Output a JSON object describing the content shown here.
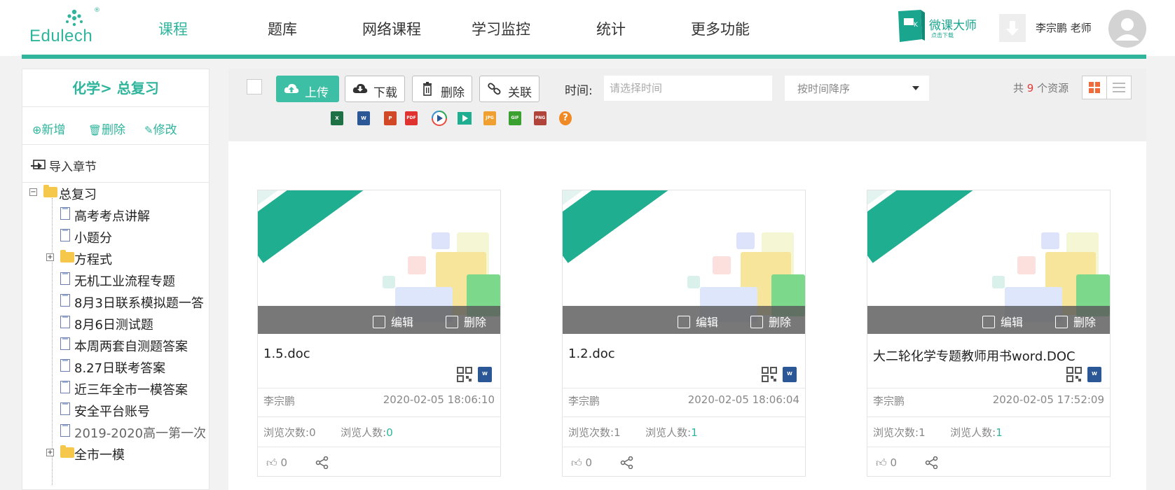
{
  "brand": {
    "logo_text": "Edulech",
    "logo_reg": "®"
  },
  "nav": [
    {
      "label": "课程",
      "active": true
    },
    {
      "label": "题库",
      "active": false
    },
    {
      "label": "网络课程",
      "active": false
    },
    {
      "label": "学习监控",
      "active": false
    },
    {
      "label": "统计",
      "active": false
    },
    {
      "label": "更多功能",
      "active": false
    }
  ],
  "weike": {
    "title": "微课大师",
    "subtitle": "点击下载"
  },
  "user": {
    "name": "李宗鹏 老师"
  },
  "sidebar": {
    "title": "化学> 总复习",
    "actions": {
      "add": "新增",
      "delete": "删除",
      "edit": "修改"
    },
    "import_label": "导入章节",
    "tree": [
      {
        "label": "总复习",
        "type": "folder",
        "expander": "minus"
      },
      {
        "label": "高考考点讲解",
        "type": "doc"
      },
      {
        "label": "小题分",
        "type": "doc"
      },
      {
        "label": "方程式",
        "type": "folder",
        "expander": "plus"
      },
      {
        "label": "无机工业流程专题",
        "type": "doc"
      },
      {
        "label": "8月3日联系模拟题一答",
        "type": "doc"
      },
      {
        "label": "8月6日测试题",
        "type": "doc"
      },
      {
        "label": "本周两套自测题答案",
        "type": "doc"
      },
      {
        "label": "8.27日联考答案",
        "type": "doc"
      },
      {
        "label": "近三年全市一模答案",
        "type": "doc"
      },
      {
        "label": "安全平台账号",
        "type": "doc"
      },
      {
        "label": "2019-2020高一第一次",
        "type": "doc"
      },
      {
        "label": "全市一模",
        "type": "folder",
        "expander": "plus"
      }
    ]
  },
  "toolbar": {
    "upload": "上传",
    "download": "下载",
    "delete": "删除",
    "link": "关联",
    "time_label": "时间:",
    "time_placeholder": "请选择时间",
    "sort_value": "按时间降序",
    "count_prefix": "共",
    "count_value": "9",
    "count_suffix": "个资源"
  },
  "file_filters": [
    {
      "name": "excel-filter-icon",
      "text": "X",
      "color": "#1e7145"
    },
    {
      "name": "word-filter-icon",
      "text": "W",
      "color": "#2b5797"
    },
    {
      "name": "ppt-filter-icon",
      "text": "P",
      "color": "#d24726"
    },
    {
      "name": "pdf-filter-icon",
      "text": "PDF",
      "color": "#e0322f"
    },
    {
      "name": "media-filter-icon",
      "text": "▶",
      "color": "#f39c12"
    },
    {
      "name": "video-filter-icon",
      "text": "▶",
      "color": "#1fae8f"
    },
    {
      "name": "jpg-filter-icon",
      "text": "JPG",
      "color": "#f0a030"
    },
    {
      "name": "gif-filter-icon",
      "text": "GIF",
      "color": "#3aa02f"
    },
    {
      "name": "png-filter-icon",
      "text": "PNG",
      "color": "#b0443a"
    },
    {
      "name": "other-filter-icon",
      "text": "?",
      "color": "#f08a24"
    }
  ],
  "cards": [
    {
      "ribbon": "Word",
      "edit": "编辑",
      "delete": "删除",
      "file_name": "1.5.doc",
      "author": "李宗鹏",
      "timestamp": "2020-02-05 18:06:10",
      "views_label": "浏览次数:",
      "views": "0",
      "viewers_label": "浏览人数:",
      "viewers": "0",
      "likes": "0"
    },
    {
      "ribbon": "Word",
      "edit": "编辑",
      "delete": "删除",
      "file_name": "1.2.doc",
      "author": "李宗鹏",
      "timestamp": "2020-02-05 18:06:04",
      "views_label": "浏览次数:",
      "views": "1",
      "viewers_label": "浏览人数:",
      "viewers": "1",
      "likes": "0"
    },
    {
      "ribbon": "Word",
      "edit": "编辑",
      "delete": "删除",
      "file_name": "大二轮化学专题教师用书word.DOC",
      "author": "李宗鹏",
      "timestamp": "2020-02-05 17:52:09",
      "views_label": "浏览次数:",
      "views": "1",
      "viewers_label": "浏览人数:",
      "viewers": "1",
      "likes": "0"
    }
  ],
  "colors": {
    "accent": "#2fb59c",
    "ribbon": "#1fae8f",
    "count_highlight": "#e23b3b"
  }
}
